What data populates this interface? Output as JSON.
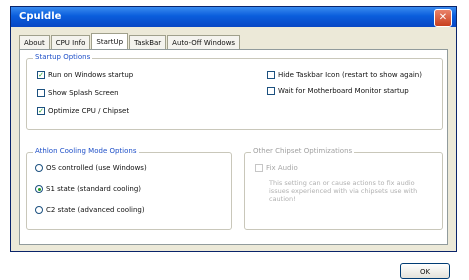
{
  "window": {
    "title": "Cpuldle",
    "close": "✕"
  },
  "tabs": [
    {
      "label": "About"
    },
    {
      "label": "CPU Info"
    },
    {
      "label": "StartUp"
    },
    {
      "label": "TaskBar"
    },
    {
      "label": "Auto-Off Windows"
    }
  ],
  "active_tab": "StartUp",
  "startup": {
    "title": "Startup Options",
    "options": [
      {
        "label": "Run on Windows startup",
        "checked": true
      },
      {
        "label": "Show Splash Screen",
        "checked": false
      },
      {
        "label": "Optimize CPU / Chipset",
        "checked": true
      },
      {
        "label": "Hide Taskbar Icon (restart to show again)",
        "checked": false
      },
      {
        "label": "Wait for Motherboard Monitor startup",
        "checked": false
      }
    ]
  },
  "athlon": {
    "title": "Athlon Cooling Mode Options",
    "options": [
      {
        "label": "OS controlled (use Windows)",
        "selected": false
      },
      {
        "label": "S1 state (standard cooling)",
        "selected": true
      },
      {
        "label": "C2 state (advanced cooling)",
        "selected": false
      }
    ]
  },
  "chipset": {
    "title": "Other Chipset Optimizations",
    "option": {
      "label": "Fix Audio",
      "checked": false
    },
    "note": "This setting can or cause actions to fix audio issues experienced with via chipsets use with caution!"
  },
  "ok_label": "OK",
  "colors": {
    "titlebar": "#0a5ddc",
    "group_title": "#1f50c8",
    "checkmark": "#21a121"
  }
}
